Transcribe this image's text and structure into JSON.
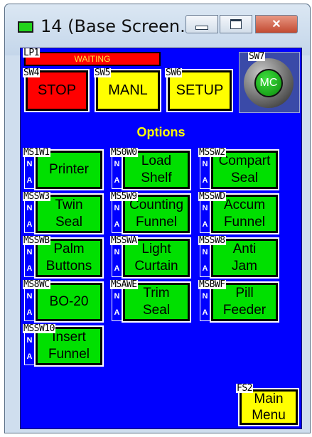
{
  "window": {
    "title": "14 (Base Screen...",
    "min_label": "",
    "max_label": "",
    "close_label": "✕"
  },
  "status": {
    "lp_tag": "LP1",
    "lamp_text": "WAITING"
  },
  "controls": [
    {
      "tag": "SW4",
      "label": "STOP",
      "color": "#ff0000"
    },
    {
      "tag": "SW5",
      "label": "MANL",
      "color": "#ffff00"
    },
    {
      "tag": "SW6",
      "label": "SETUP",
      "color": "#ffff00"
    }
  ],
  "mc": {
    "tag": "SW7",
    "label": "MC"
  },
  "options_title": "Options",
  "options": [
    {
      "tag": "MS1W1",
      "n": "N",
      "a": "A",
      "line1": "Printer",
      "line2": ""
    },
    {
      "tag": "MS0W0",
      "n": "N",
      "a": "A",
      "line1": "Load",
      "line2": "Shelf"
    },
    {
      "tag": "MSSW2",
      "n": "N",
      "a": "A",
      "line1": "Compart",
      "line2": "Seal"
    },
    {
      "tag": "MSSW3",
      "n": "N",
      "a": "A",
      "line1": "Twin",
      "line2": "Seal"
    },
    {
      "tag": "MS5W9",
      "n": "N",
      "a": "A",
      "line1": "Counting",
      "line2": "Funnel"
    },
    {
      "tag": "MSSWD",
      "n": "N",
      "a": "A",
      "line1": "Accum",
      "line2": "Funnel"
    },
    {
      "tag": "MSSWB",
      "n": "N",
      "a": "A",
      "line1": "Palm",
      "line2": "Buttons"
    },
    {
      "tag": "MSSWA",
      "n": "N",
      "a": "A",
      "line1": "Light",
      "line2": "Curtain"
    },
    {
      "tag": "MSSW8",
      "n": "N",
      "a": "A",
      "line1": "Anti",
      "line2": "Jam"
    },
    {
      "tag": "MS8WC",
      "n": "N",
      "a": "A",
      "line1": "BO-20",
      "line2": ""
    },
    {
      "tag": "MSAWE",
      "n": "N",
      "a": "A",
      "line1": "Trim",
      "line2": "Seal"
    },
    {
      "tag": "MSBWF",
      "n": "N",
      "a": "A",
      "line1": "Pill",
      "line2": "Feeder"
    },
    {
      "tag": "MSSW10",
      "n": "N",
      "a": "A",
      "line1": "Insert",
      "line2": "Funnel"
    }
  ],
  "main_menu": {
    "tag": "FS2",
    "line1": "Main",
    "line2": "Menu"
  }
}
